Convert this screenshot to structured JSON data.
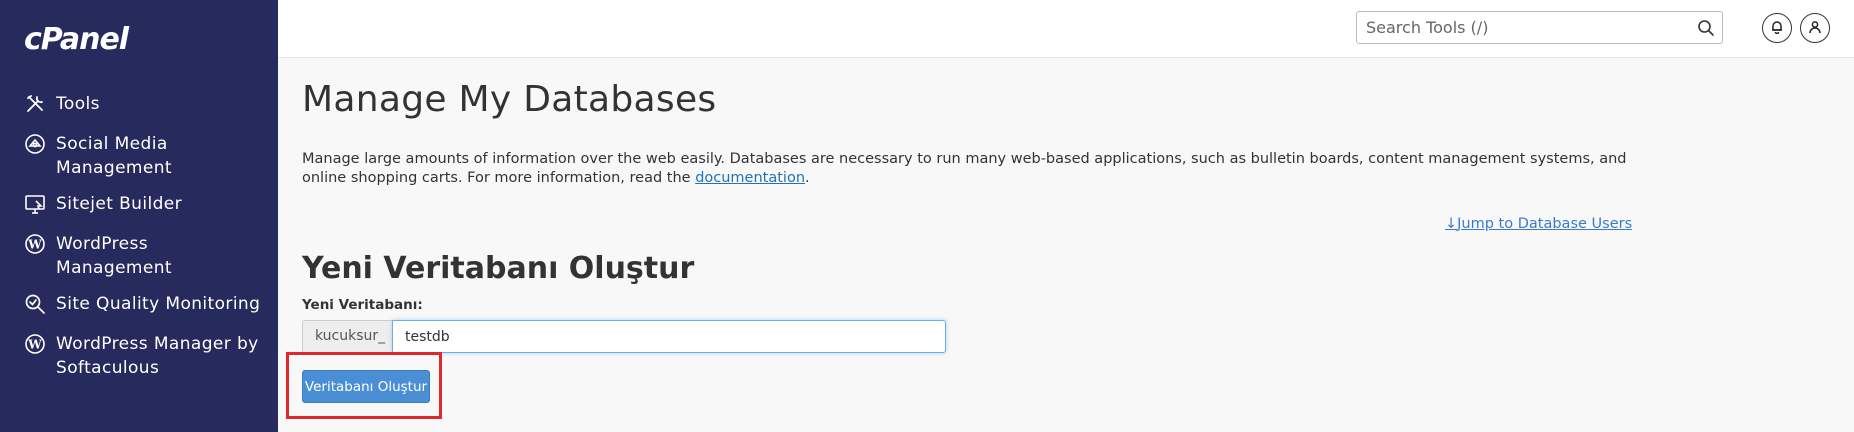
{
  "brand": {
    "logo_text": "cPanel"
  },
  "sidebar": {
    "items": [
      {
        "label": "Tools",
        "icon": "tools-icon"
      },
      {
        "label": "Social Media\nManagement",
        "icon": "social-media-icon"
      },
      {
        "label": "Sitejet Builder",
        "icon": "sitejet-icon"
      },
      {
        "label": "WordPress\nManagement",
        "icon": "wordpress-icon"
      },
      {
        "label": "Site Quality Monitoring",
        "icon": "site-quality-icon"
      },
      {
        "label": "WordPress Manager by\nSoftaculous",
        "icon": "wordpress-icon"
      }
    ]
  },
  "topbar": {
    "search_placeholder": "Search Tools (/)",
    "notifications_icon": "bell-icon",
    "user_icon": "user-icon"
  },
  "main": {
    "title": "Manage My Databases",
    "description_text": "Manage large amounts of information over the web easily. Databases are necessary to run many web-based applications, such as bulletin boards, content management systems, and online shopping carts. For more information, read the ",
    "description_link": "documentation",
    "description_end": ".",
    "jump_link": "Jump to Database Users",
    "create_section": {
      "title": "Yeni Veritabanı Oluştur",
      "field_label": "Yeni Veritabanı:",
      "prefix": "kucuksur_",
      "value": "testdb",
      "button_label": "Veritabanı Oluştur"
    }
  },
  "colors": {
    "sidebar_bg": "#272a5c",
    "primary_button": "#4a8fd5",
    "highlight_border": "#e0282f",
    "link": "#1f73b7"
  }
}
